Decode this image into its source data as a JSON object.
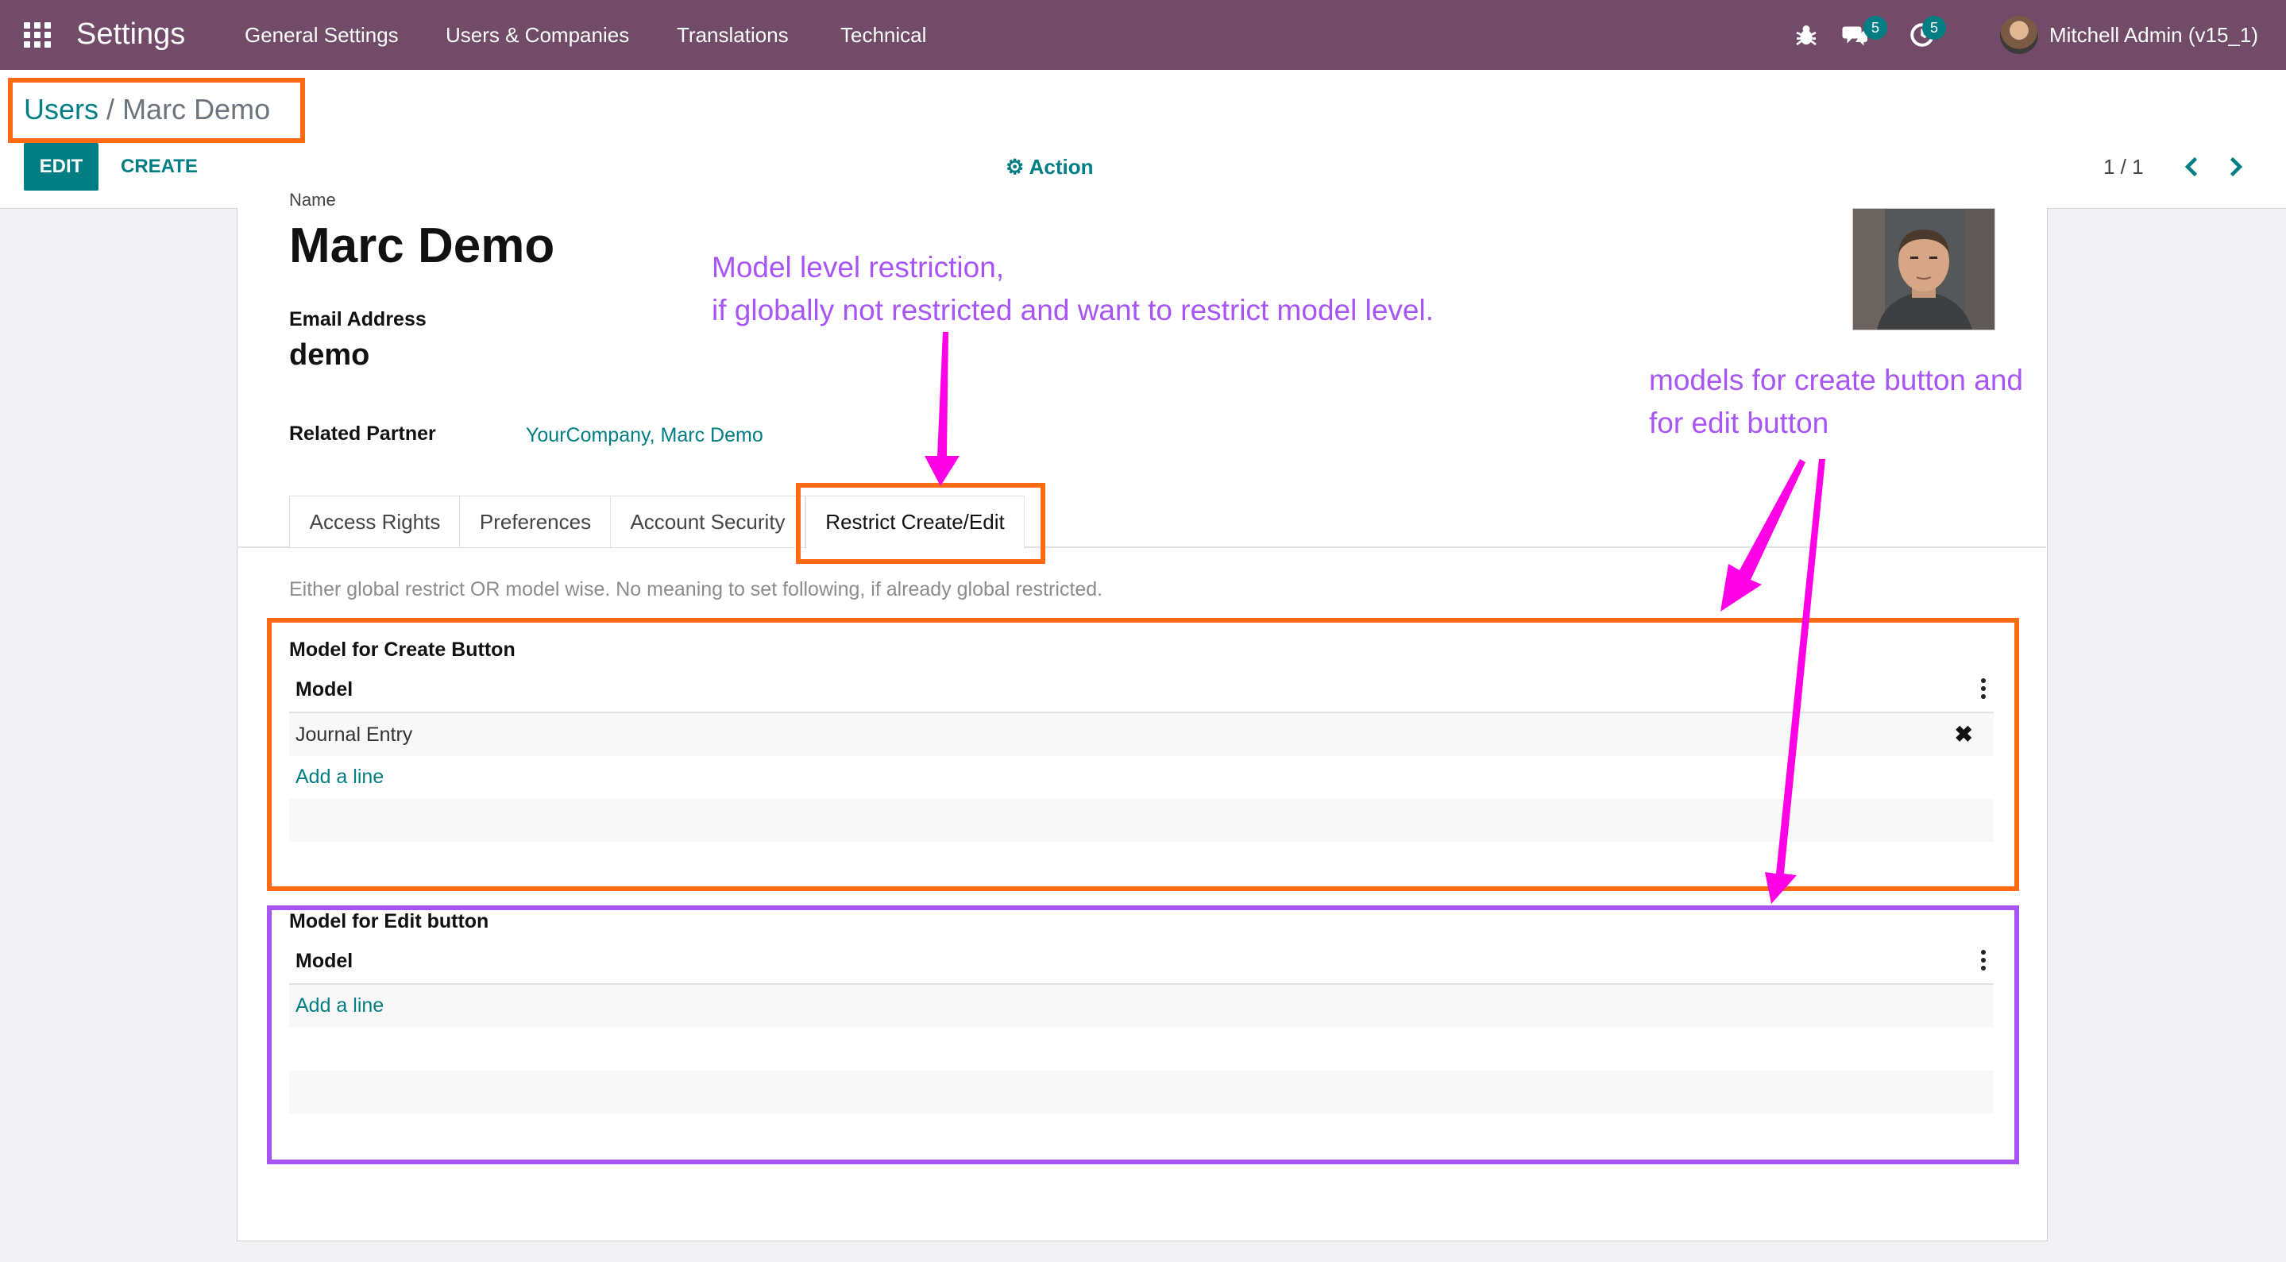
{
  "navbar": {
    "brand": "Settings",
    "menu": [
      "General Settings",
      "Users & Companies",
      "Translations",
      "Technical"
    ],
    "messages_count": "5",
    "activities_count": "5",
    "user_name": "Mitchell Admin (v15_1)"
  },
  "breadcrumb": {
    "parent": "Users",
    "separator": "/",
    "current": "Marc Demo"
  },
  "buttons": {
    "edit": "EDIT",
    "create": "CREATE",
    "action": "Action"
  },
  "pager": {
    "value": "1 / 1"
  },
  "form": {
    "name_label": "Name",
    "name": "Marc Demo",
    "email_label": "Email Address",
    "email": "demo",
    "partner_label": "Related Partner",
    "partner": "YourCompany, Marc Demo",
    "tabs": [
      "Access Rights",
      "Preferences",
      "Account Security",
      "Restrict Create/Edit"
    ],
    "active_tab": "Restrict Create/Edit",
    "note": "Either global restrict OR model wise. No meaning to set following, if already global restricted.",
    "create_section": {
      "title": "Model for Create Button",
      "column": "Model",
      "rows": [
        "Journal Entry"
      ],
      "add_line": "Add a line"
    },
    "edit_section": {
      "title": "Model for Edit button",
      "column": "Model",
      "rows": [],
      "add_line": "Add a line"
    }
  },
  "annotations": {
    "model_level_line1": "Model level restriction,",
    "model_level_line2": "if globally not restricted and want to restrict model level.",
    "models_line1": "models for create button and",
    "models_line2": "for edit button",
    "orange": "#ff6a13",
    "purple": "#a855f7",
    "magenta": "#ff00e6"
  },
  "colors": {
    "navbar": "#714b67",
    "primary": "#017e84"
  }
}
